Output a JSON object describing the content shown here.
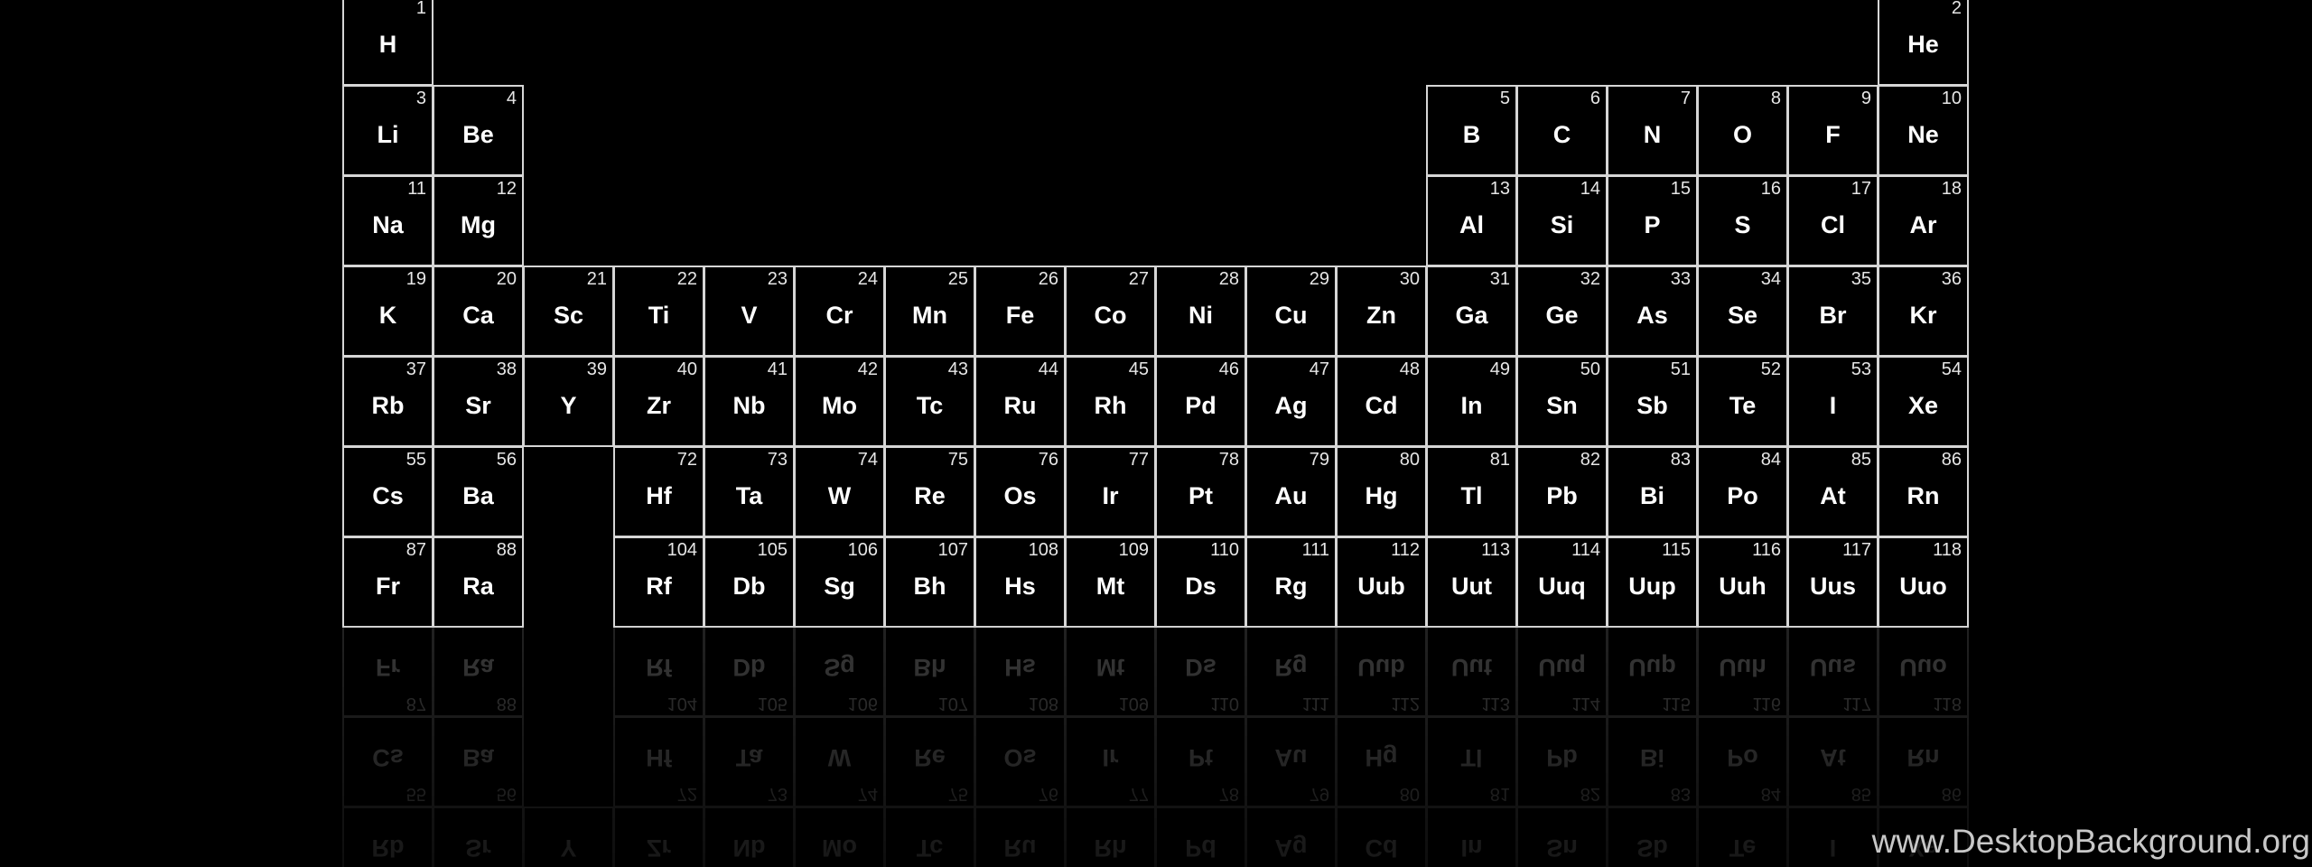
{
  "elements": [
    {
      "n": "1",
      "s": "H",
      "row": 1,
      "col": 1
    },
    {
      "n": "2",
      "s": "He",
      "row": 1,
      "col": 18
    },
    {
      "n": "3",
      "s": "Li",
      "row": 2,
      "col": 1
    },
    {
      "n": "4",
      "s": "Be",
      "row": 2,
      "col": 2
    },
    {
      "n": "5",
      "s": "B",
      "row": 2,
      "col": 13
    },
    {
      "n": "6",
      "s": "C",
      "row": 2,
      "col": 14
    },
    {
      "n": "7",
      "s": "N",
      "row": 2,
      "col": 15
    },
    {
      "n": "8",
      "s": "O",
      "row": 2,
      "col": 16
    },
    {
      "n": "9",
      "s": "F",
      "row": 2,
      "col": 17
    },
    {
      "n": "10",
      "s": "Ne",
      "row": 2,
      "col": 18
    },
    {
      "n": "11",
      "s": "Na",
      "row": 3,
      "col": 1
    },
    {
      "n": "12",
      "s": "Mg",
      "row": 3,
      "col": 2
    },
    {
      "n": "13",
      "s": "Al",
      "row": 3,
      "col": 13
    },
    {
      "n": "14",
      "s": "Si",
      "row": 3,
      "col": 14
    },
    {
      "n": "15",
      "s": "P",
      "row": 3,
      "col": 15
    },
    {
      "n": "16",
      "s": "S",
      "row": 3,
      "col": 16
    },
    {
      "n": "17",
      "s": "Cl",
      "row": 3,
      "col": 17
    },
    {
      "n": "18",
      "s": "Ar",
      "row": 3,
      "col": 18
    },
    {
      "n": "19",
      "s": "K",
      "row": 4,
      "col": 1
    },
    {
      "n": "20",
      "s": "Ca",
      "row": 4,
      "col": 2
    },
    {
      "n": "21",
      "s": "Sc",
      "row": 4,
      "col": 3
    },
    {
      "n": "22",
      "s": "Ti",
      "row": 4,
      "col": 4
    },
    {
      "n": "23",
      "s": "V",
      "row": 4,
      "col": 5
    },
    {
      "n": "24",
      "s": "Cr",
      "row": 4,
      "col": 6
    },
    {
      "n": "25",
      "s": "Mn",
      "row": 4,
      "col": 7
    },
    {
      "n": "26",
      "s": "Fe",
      "row": 4,
      "col": 8
    },
    {
      "n": "27",
      "s": "Co",
      "row": 4,
      "col": 9
    },
    {
      "n": "28",
      "s": "Ni",
      "row": 4,
      "col": 10
    },
    {
      "n": "29",
      "s": "Cu",
      "row": 4,
      "col": 11
    },
    {
      "n": "30",
      "s": "Zn",
      "row": 4,
      "col": 12
    },
    {
      "n": "31",
      "s": "Ga",
      "row": 4,
      "col": 13
    },
    {
      "n": "32",
      "s": "Ge",
      "row": 4,
      "col": 14
    },
    {
      "n": "33",
      "s": "As",
      "row": 4,
      "col": 15
    },
    {
      "n": "34",
      "s": "Se",
      "row": 4,
      "col": 16
    },
    {
      "n": "35",
      "s": "Br",
      "row": 4,
      "col": 17
    },
    {
      "n": "36",
      "s": "Kr",
      "row": 4,
      "col": 18
    },
    {
      "n": "37",
      "s": "Rb",
      "row": 5,
      "col": 1
    },
    {
      "n": "38",
      "s": "Sr",
      "row": 5,
      "col": 2
    },
    {
      "n": "39",
      "s": "Y",
      "row": 5,
      "col": 3
    },
    {
      "n": "40",
      "s": "Zr",
      "row": 5,
      "col": 4
    },
    {
      "n": "41",
      "s": "Nb",
      "row": 5,
      "col": 5
    },
    {
      "n": "42",
      "s": "Mo",
      "row": 5,
      "col": 6
    },
    {
      "n": "43",
      "s": "Tc",
      "row": 5,
      "col": 7
    },
    {
      "n": "44",
      "s": "Ru",
      "row": 5,
      "col": 8
    },
    {
      "n": "45",
      "s": "Rh",
      "row": 5,
      "col": 9
    },
    {
      "n": "46",
      "s": "Pd",
      "row": 5,
      "col": 10
    },
    {
      "n": "47",
      "s": "Ag",
      "row": 5,
      "col": 11
    },
    {
      "n": "48",
      "s": "Cd",
      "row": 5,
      "col": 12
    },
    {
      "n": "49",
      "s": "In",
      "row": 5,
      "col": 13
    },
    {
      "n": "50",
      "s": "Sn",
      "row": 5,
      "col": 14
    },
    {
      "n": "51",
      "s": "Sb",
      "row": 5,
      "col": 15
    },
    {
      "n": "52",
      "s": "Te",
      "row": 5,
      "col": 16
    },
    {
      "n": "53",
      "s": "I",
      "row": 5,
      "col": 17
    },
    {
      "n": "54",
      "s": "Xe",
      "row": 5,
      "col": 18
    },
    {
      "n": "55",
      "s": "Cs",
      "row": 6,
      "col": 1
    },
    {
      "n": "56",
      "s": "Ba",
      "row": 6,
      "col": 2
    },
    {
      "n": "72",
      "s": "Hf",
      "row": 6,
      "col": 4
    },
    {
      "n": "73",
      "s": "Ta",
      "row": 6,
      "col": 5
    },
    {
      "n": "74",
      "s": "W",
      "row": 6,
      "col": 6
    },
    {
      "n": "75",
      "s": "Re",
      "row": 6,
      "col": 7
    },
    {
      "n": "76",
      "s": "Os",
      "row": 6,
      "col": 8
    },
    {
      "n": "77",
      "s": "Ir",
      "row": 6,
      "col": 9
    },
    {
      "n": "78",
      "s": "Pt",
      "row": 6,
      "col": 10
    },
    {
      "n": "79",
      "s": "Au",
      "row": 6,
      "col": 11
    },
    {
      "n": "80",
      "s": "Hg",
      "row": 6,
      "col": 12
    },
    {
      "n": "81",
      "s": "Tl",
      "row": 6,
      "col": 13
    },
    {
      "n": "82",
      "s": "Pb",
      "row": 6,
      "col": 14
    },
    {
      "n": "83",
      "s": "Bi",
      "row": 6,
      "col": 15
    },
    {
      "n": "84",
      "s": "Po",
      "row": 6,
      "col": 16
    },
    {
      "n": "85",
      "s": "At",
      "row": 6,
      "col": 17
    },
    {
      "n": "86",
      "s": "Rn",
      "row": 6,
      "col": 18
    },
    {
      "n": "87",
      "s": "Fr",
      "row": 7,
      "col": 1
    },
    {
      "n": "88",
      "s": "Ra",
      "row": 7,
      "col": 2
    },
    {
      "n": "104",
      "s": "Rf",
      "row": 7,
      "col": 4
    },
    {
      "n": "105",
      "s": "Db",
      "row": 7,
      "col": 5
    },
    {
      "n": "106",
      "s": "Sg",
      "row": 7,
      "col": 6
    },
    {
      "n": "107",
      "s": "Bh",
      "row": 7,
      "col": 7
    },
    {
      "n": "108",
      "s": "Hs",
      "row": 7,
      "col": 8
    },
    {
      "n": "109",
      "s": "Mt",
      "row": 7,
      "col": 9
    },
    {
      "n": "110",
      "s": "Ds",
      "row": 7,
      "col": 10
    },
    {
      "n": "111",
      "s": "Rg",
      "row": 7,
      "col": 11
    },
    {
      "n": "112",
      "s": "Uub",
      "row": 7,
      "col": 12
    },
    {
      "n": "113",
      "s": "Uut",
      "row": 7,
      "col": 13
    },
    {
      "n": "114",
      "s": "Uuq",
      "row": 7,
      "col": 14
    },
    {
      "n": "115",
      "s": "Uup",
      "row": 7,
      "col": 15
    },
    {
      "n": "116",
      "s": "Uuh",
      "row": 7,
      "col": 16
    },
    {
      "n": "117",
      "s": "Uus",
      "row": 7,
      "col": 17
    },
    {
      "n": "118",
      "s": "Uuo",
      "row": 7,
      "col": 18
    }
  ],
  "colors": {
    "background": "#000000",
    "cell_border": "#d6d6d6",
    "symbol_text": "#ffffff",
    "number_text": "#e6e6e6",
    "watermark_text": "#c8c8c8"
  },
  "watermark": "www.DesktopBackground.org"
}
